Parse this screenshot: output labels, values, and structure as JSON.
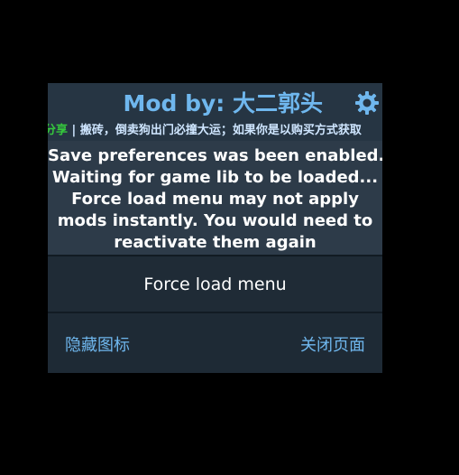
{
  "header": {
    "title": "Mod by:  大二郭头",
    "settings_icon": "gear-icon"
  },
  "marquee": {
    "highlight": "分享",
    "text": " | 搬砖，倒卖狗出门必撞大运；如果你是以购买方式获取"
  },
  "message": {
    "lines": [
      "Save preferences was been enabled.",
      "Waiting for game lib to be loaded...",
      "Force load menu may not apply",
      "mods instantly. You would need to",
      "reactivate them again"
    ]
  },
  "force_button": {
    "label": "Force load menu"
  },
  "footer": {
    "hide_label": "隐藏图标",
    "close_label": "关闭页面"
  },
  "colors": {
    "accent": "#6fb7ee",
    "panel_bg": "#1e2a35",
    "header_bg": "#263543",
    "message_bg": "#2d3b49",
    "marquee_green": "#35c93c"
  }
}
